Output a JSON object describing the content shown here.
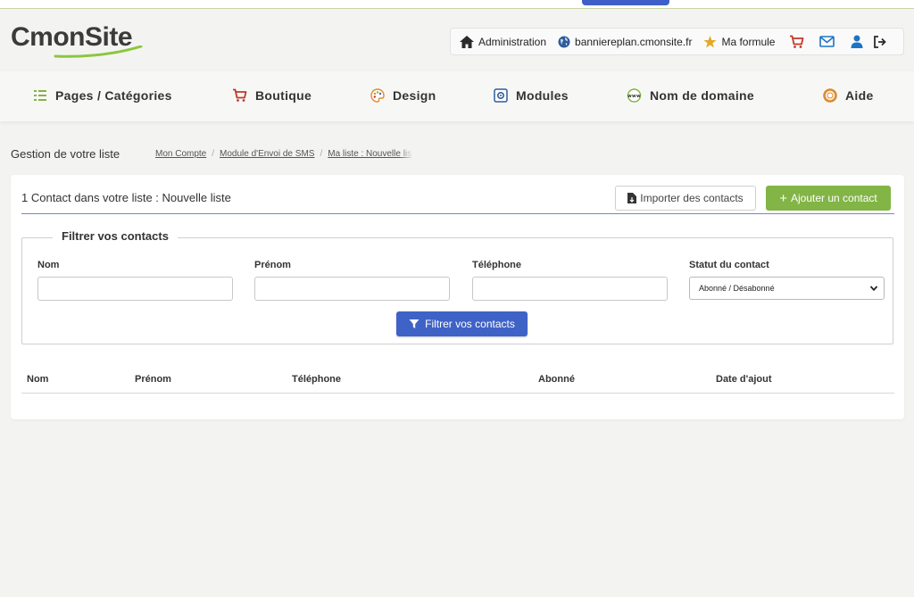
{
  "logo": {
    "text_a": "Cmon",
    "text_b": "Site",
    "swoosh_color": "#8cc63f"
  },
  "toolbar": {
    "admin_label": "Administration",
    "site_label": "banniereplan.cmonsite.fr",
    "plan_label": "Ma formule",
    "icons": [
      "home-icon",
      "globe-icon",
      "star-icon",
      "cart-icon",
      "mail-icon",
      "user-icon",
      "logout-icon"
    ]
  },
  "nav": {
    "items": [
      {
        "label": "Pages / Catégories",
        "icon": "pages-list-icon"
      },
      {
        "label": "Boutique",
        "icon": "cart-icon"
      },
      {
        "label": "Design",
        "icon": "palette-icon"
      },
      {
        "label": "Modules",
        "icon": "gear-icon"
      },
      {
        "label": "Nom de domaine",
        "icon": "www-icon"
      },
      {
        "label": "Aide",
        "icon": "lifebuoy-icon"
      }
    ]
  },
  "page": {
    "title": "Gestion de votre liste"
  },
  "breadcrumb": [
    "Mon Compte",
    "Module d'Envoi de SMS",
    "Ma liste : Nouvelle lis"
  ],
  "card": {
    "title": "1 Contact dans votre liste : Nouvelle liste",
    "import_label": "Importer des contacts",
    "add_label": "Ajouter un contact"
  },
  "filter": {
    "legend": "Filtrer vos contacts",
    "fields": {
      "nom": {
        "label": "Nom",
        "value": ""
      },
      "prenom": {
        "label": "Prénom",
        "value": ""
      },
      "telephone": {
        "label": "Téléphone",
        "value": ""
      },
      "statut": {
        "label": "Statut du contact",
        "selected": "Abonné / Désabonné"
      }
    },
    "button_label": "Filtrer vos contacts"
  },
  "table": {
    "headers": [
      "Nom",
      "Prénom",
      "Téléphone",
      "Abonné",
      "Date d'ajout"
    ],
    "rows": []
  },
  "colors": {
    "green_accent": "#82b446",
    "blue_accent": "#3f62c6",
    "cart_red": "#c0392b",
    "icon_blue": "#1d74c4"
  }
}
